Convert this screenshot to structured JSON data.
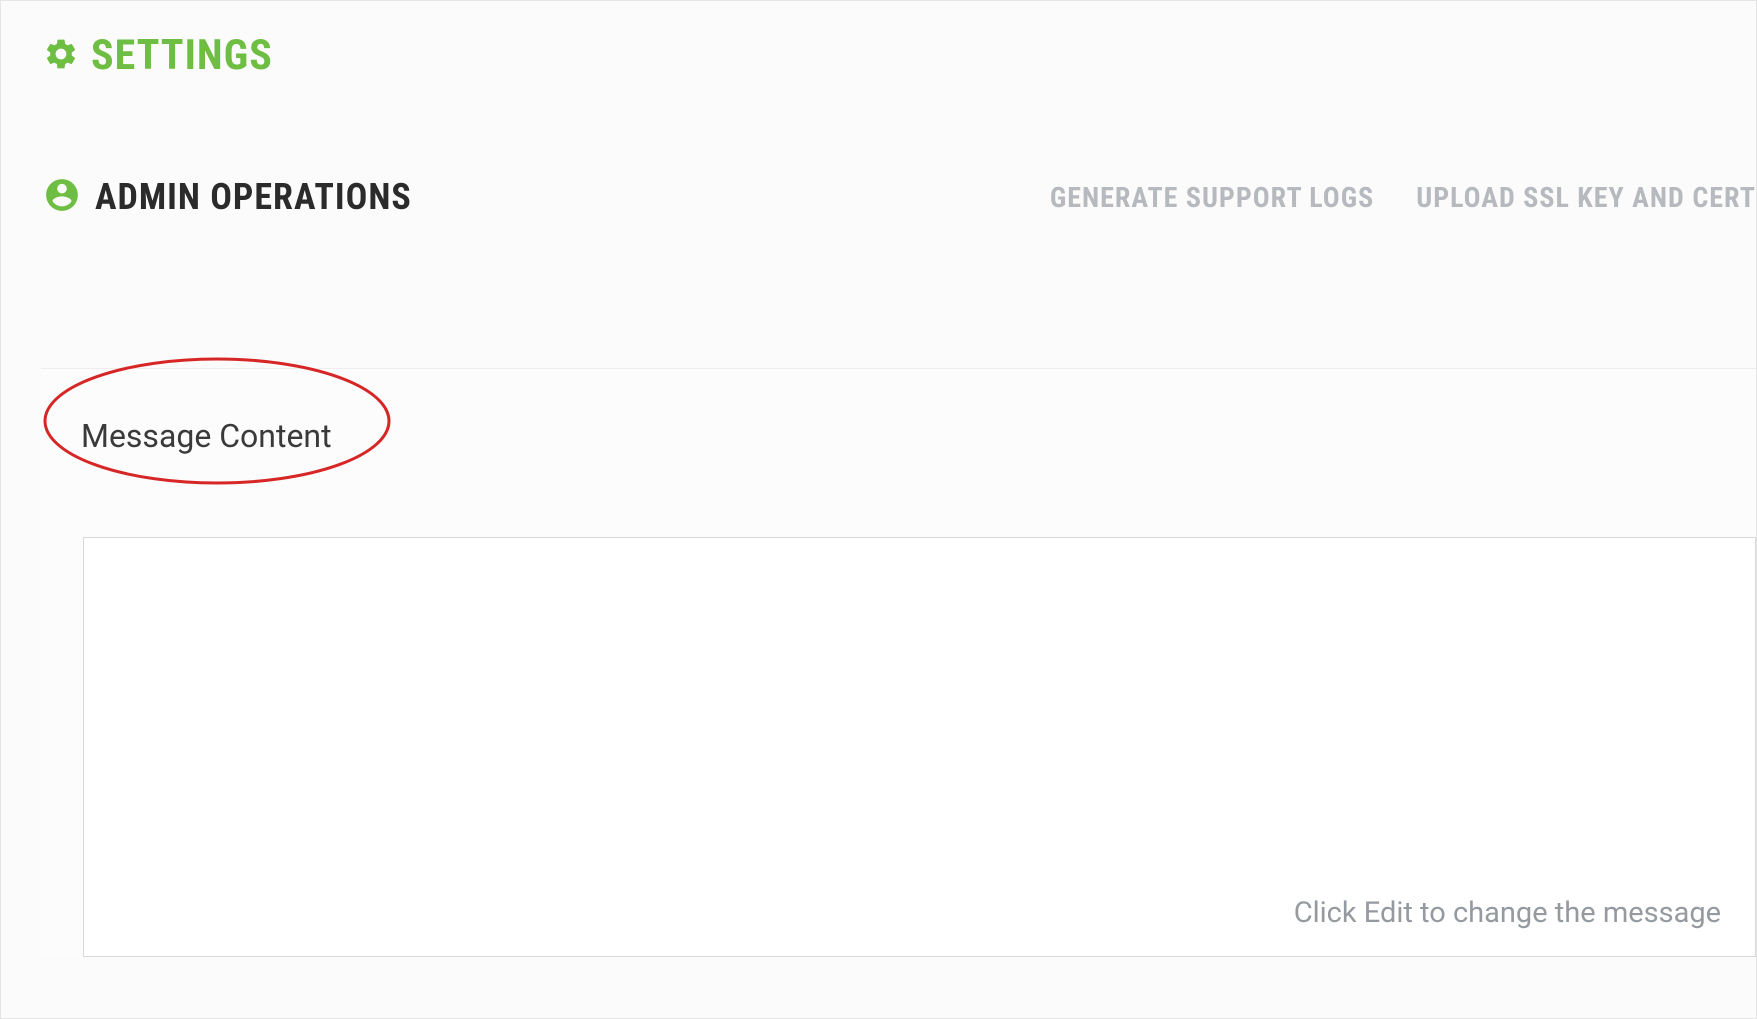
{
  "page": {
    "title": "SETTINGS"
  },
  "section": {
    "title": "ADMIN OPERATIONS",
    "actions": {
      "generate_logs": "GENERATE SUPPORT LOGS",
      "upload_ssl": "UPLOAD SSL KEY AND CERT"
    }
  },
  "content": {
    "heading": "Message Content",
    "placeholder": "Click Edit to change the message"
  }
}
